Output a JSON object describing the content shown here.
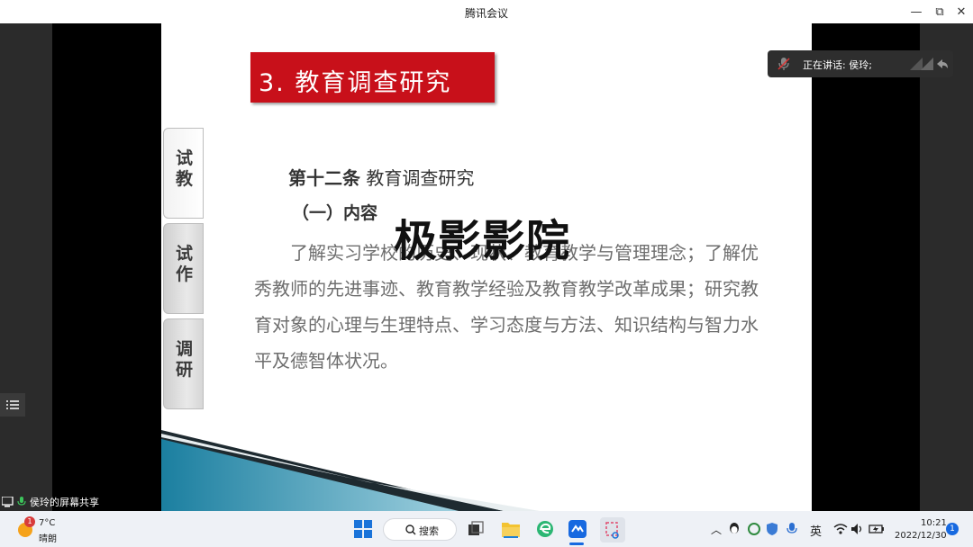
{
  "window": {
    "title": "腾讯会议",
    "minimize": "—",
    "restore": "⧉",
    "close": "✕"
  },
  "slide": {
    "title": "3. 教育调查研究",
    "tabs": [
      {
        "label": "试\n教"
      },
      {
        "label": "试\n作"
      },
      {
        "label": "调\n研"
      }
    ],
    "heading_bold": "第十二条",
    "heading_rest": " 教育调查研究",
    "subheading": "（一）内容",
    "paragraph": "了解实习学校的历史、现状、教育教学与管理理念；了解优秀教师的先进事迹、教育教学经验及教育教学改革成果；研究教育对象的心理与生理特点、学习态度与方法、知识结构与智力水平及德智体状况。",
    "watermark": "极影影院"
  },
  "speaker_panel": {
    "text": "正在讲话: 侯玲;"
  },
  "screen_share": {
    "text": "侯玲的屏幕共享"
  },
  "taskbar": {
    "weather_temp": "7°C",
    "weather_desc": "晴朗",
    "weather_badge": "1",
    "search_label": "搜索",
    "ime": "英",
    "time": "10:21",
    "date": "2022/12/30",
    "notification_count": "1"
  },
  "colors": {
    "title_red": "#c8101a",
    "taskbar_bg": "#eef1f6",
    "dark_panel": "#2b2b2b"
  }
}
